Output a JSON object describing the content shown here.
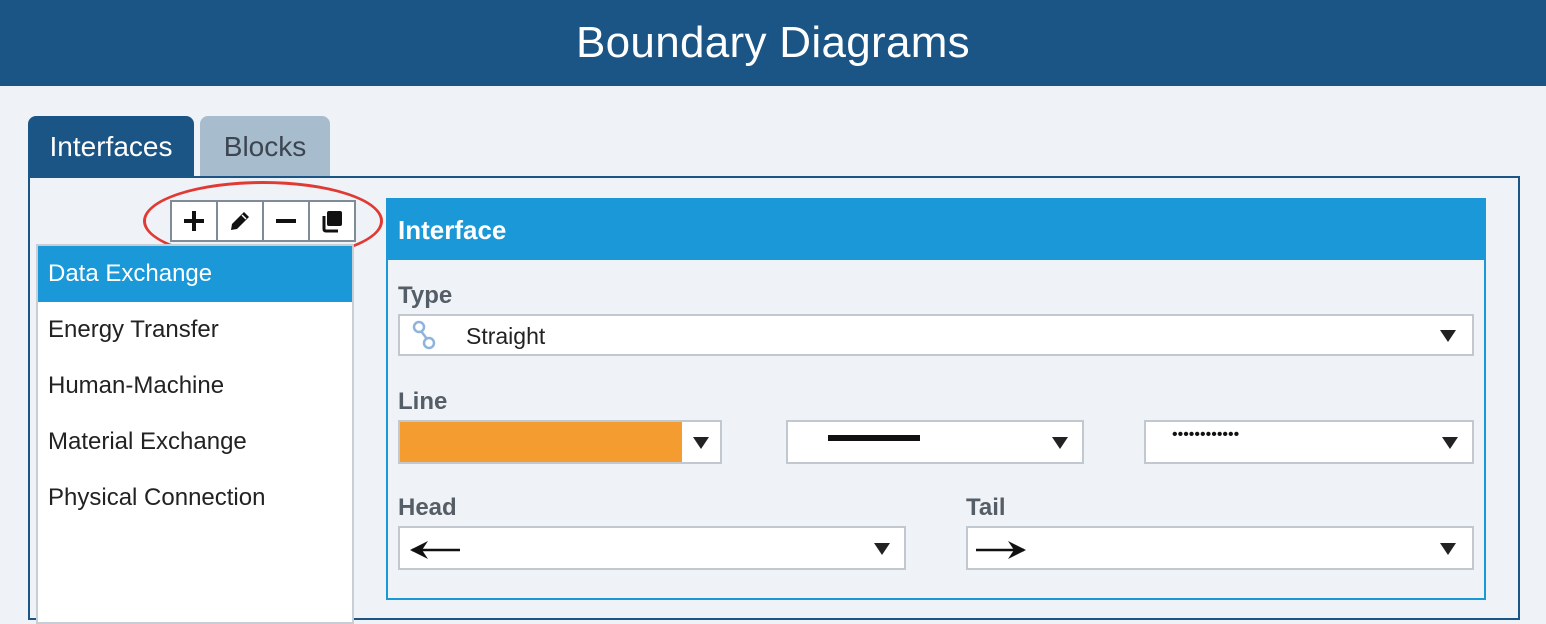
{
  "header": {
    "title": "Boundary Diagrams"
  },
  "tabs": [
    {
      "label": "Interfaces",
      "active": true
    },
    {
      "label": "Blocks",
      "active": false
    }
  ],
  "toolbar": {
    "buttons": [
      {
        "icon": "plus-icon"
      },
      {
        "icon": "pencil-icon"
      },
      {
        "icon": "minus-icon"
      },
      {
        "icon": "copy-icon"
      }
    ],
    "highlight_color": "#e03a35"
  },
  "interface_list": {
    "items": [
      {
        "label": "Data Exchange",
        "selected": true
      },
      {
        "label": "Energy Transfer",
        "selected": false
      },
      {
        "label": "Human-Machine",
        "selected": false
      },
      {
        "label": "Material Exchange",
        "selected": false
      },
      {
        "label": "Physical Connection",
        "selected": false
      }
    ]
  },
  "interface": {
    "title": "Interface",
    "type": {
      "label": "Type",
      "value": "Straight",
      "icon": "connector-icon"
    },
    "line": {
      "label": "Line",
      "color": "#f59c30",
      "width_icon": "solid-line-icon",
      "style_value": "••••••••••••"
    },
    "head": {
      "label": "Head",
      "icon": "arrow-left-icon"
    },
    "tail": {
      "label": "Tail",
      "icon": "arrow-right-icon"
    }
  },
  "colors": {
    "header_bg": "#1b5585",
    "accent": "#1a98d8",
    "tab_inactive": "#a7bccd"
  }
}
